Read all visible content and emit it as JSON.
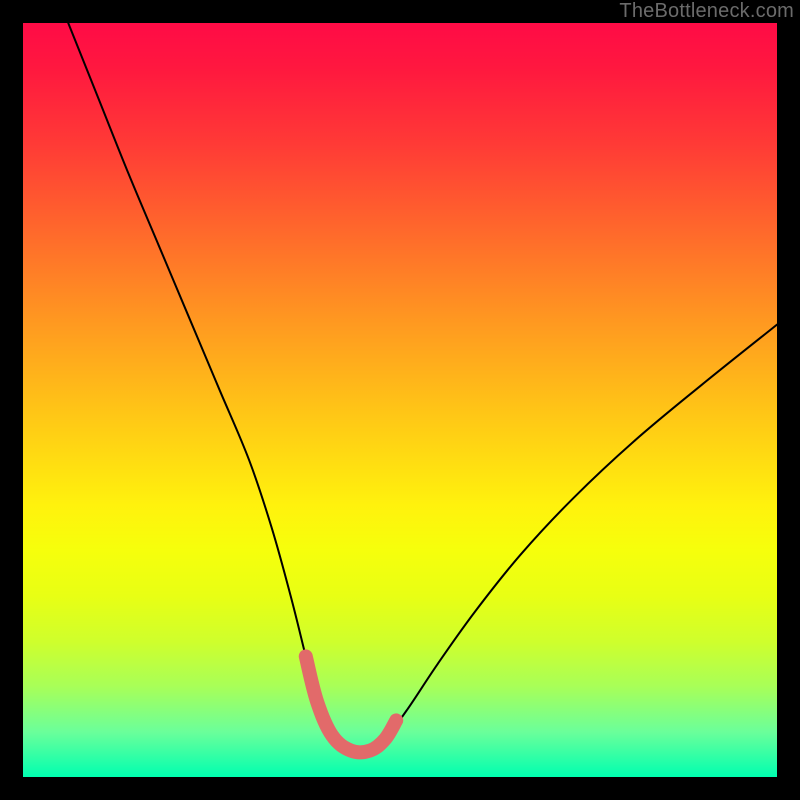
{
  "watermark": {
    "text": "TheBottleneck.com"
  },
  "chart_data": {
    "type": "line",
    "title": "",
    "xlabel": "",
    "ylabel": "",
    "xlim": [
      0,
      100
    ],
    "ylim": [
      0,
      100
    ],
    "grid": false,
    "legend": false,
    "series": [
      {
        "name": "bottleneck-curve",
        "x": [
          6,
          10,
          14,
          18,
          22,
          26,
          30,
          33,
          35.5,
          37.5,
          39,
          41,
          43.5,
          46,
          48,
          51,
          55,
          60,
          66,
          73,
          81,
          90,
          100
        ],
        "y": [
          100,
          90,
          80,
          70.5,
          61,
          51.5,
          42,
          33,
          24,
          16,
          10,
          5.5,
          3.5,
          3.5,
          5,
          9,
          15,
          22,
          29.5,
          37,
          44.5,
          52,
          60
        ]
      },
      {
        "name": "optimal-band-highlight",
        "x": [
          37.5,
          39,
          41,
          43.5,
          46,
          48,
          49.5
        ],
        "y": [
          16,
          10,
          5.5,
          3.5,
          3.5,
          5,
          7.5
        ]
      }
    ],
    "colors": {
      "curve": "#000000",
      "highlight": "#e26a6a",
      "gradient_top": "#ff0b46",
      "gradient_bottom": "#00ffb0"
    },
    "notes": "Axes unlabeled in source; values estimated on a 0–100 scale where y=0 is the bottom of the colored plot area and x=0 the left edge. The pink segment marks the trough of the curve."
  }
}
